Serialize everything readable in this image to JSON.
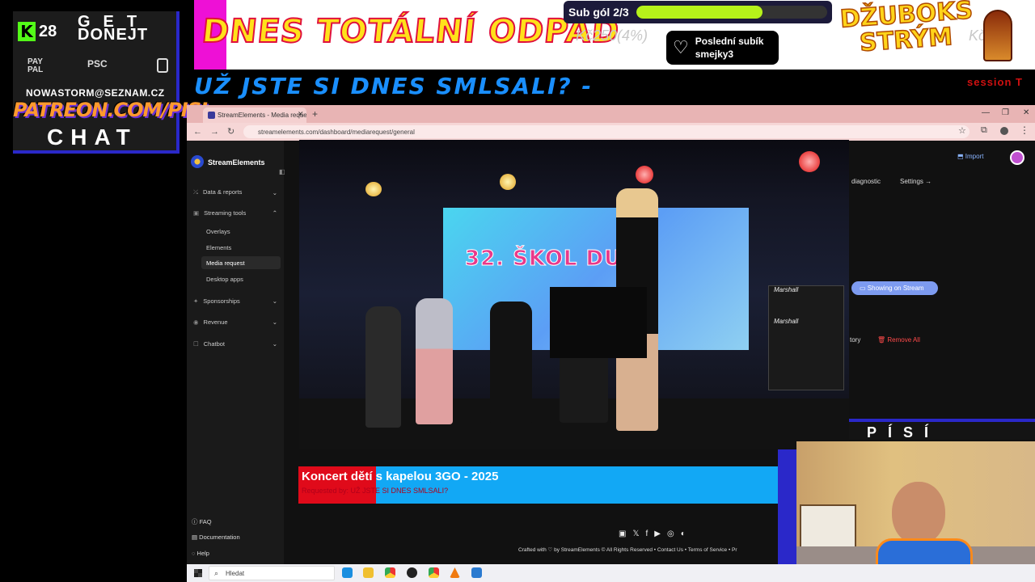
{
  "overlay": {
    "kick": {
      "logo": "K",
      "count": "28"
    },
    "donate": {
      "get": "GET",
      "donejt": "DONEJT",
      "paypal": "PAY PAL",
      "psc": "PSC",
      "email": "NOWASTORM@SEZNAM.CZ",
      "patreon": "PATREON.COM/PISI",
      "chat": "CHAT"
    },
    "banner_title": "DNES TOTÁLNÍ ODPAD",
    "sub_goal": {
      "label": "Sub gól 2/3",
      "progress": 0.66,
      "fill_color": "#b6f21a"
    },
    "price_a": "Kč250(4%)",
    "price_b": "Kč59",
    "last_sub": {
      "heading": "Poslední subík",
      "name": "smejky3"
    },
    "jukebox_title_line1": "DŽUBOKS",
    "jukebox_title_line2": "STRÝM",
    "ticker": "UŽ JSTE SI DNES SMLSALI? -",
    "session": "session T",
    "cam_label": "PÍSÍ"
  },
  "browser": {
    "tab_title": "StreamElements - Media reques",
    "url": "streamelements.com/dashboard/mediarequest/general"
  },
  "sidebar": {
    "brand": "StreamElements",
    "items": [
      {
        "label": "Data & reports",
        "icon": "chart-icon"
      },
      {
        "label": "Streaming tools",
        "icon": "tools-icon"
      },
      {
        "label": "Overlays"
      },
      {
        "label": "Elements"
      },
      {
        "label": "Media request"
      },
      {
        "label": "Desktop apps"
      },
      {
        "label": "Sponsorships",
        "icon": "star-icon"
      },
      {
        "label": "Revenue",
        "icon": "dollar-icon"
      },
      {
        "label": "Chatbot",
        "icon": "bot-icon"
      }
    ],
    "footer": [
      {
        "label": "FAQ"
      },
      {
        "label": "Documentation"
      },
      {
        "label": "Help"
      }
    ]
  },
  "dashboard": {
    "import": "Import",
    "diagnostic": "diagnostic",
    "settings": "Settings",
    "showing_on_stream": "Showing on Stream",
    "history": "tory",
    "remove_all": "Remove All"
  },
  "video": {
    "screen_text": "32. ŠKOL   DUT",
    "amp_brand": "Marshall"
  },
  "caption": {
    "title": "Koncert dětí s kapelou 3GO - 2025",
    "requested_by": "Requested by: UŽ JSTE SI DNES SMLSALI?"
  },
  "footer_bar": {
    "crafted": "Crafted with ♡ by  StreamElements   © All Rights Reserved  • Contact Us  • Terms of Service  • Pr"
  },
  "taskbar": {
    "search_placeholder": "Hledat"
  },
  "colors": {
    "accent_blue": "#1a8fff",
    "brand_purple": "#2a28c9",
    "magenta": "#ee10d6"
  }
}
